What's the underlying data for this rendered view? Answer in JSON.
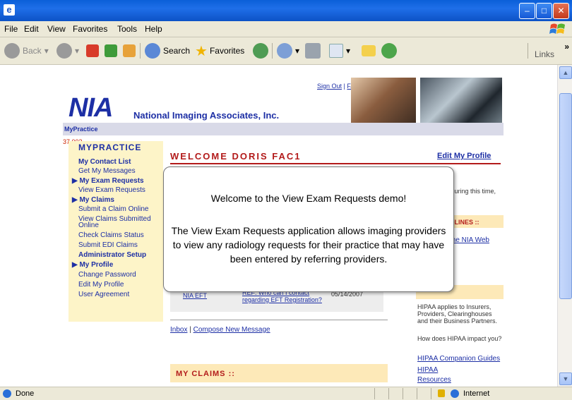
{
  "window": {
    "min": "–",
    "max": "□",
    "close": "✕"
  },
  "menu": [
    "File",
    "Edit",
    "View",
    "Favorites",
    "Tools",
    "Help"
  ],
  "toolbar": {
    "back": "Back",
    "search": "Search",
    "favorites": "Favorites",
    "links": "Links"
  },
  "header": {
    "logo": "NIA",
    "company": "National Imaging Associates, Inc.",
    "sign_out": "Sign Out",
    "faqs": "FAQs",
    "separator": "|",
    "breadcrumb": "MyPractice",
    "version": "37.002"
  },
  "sidebar": {
    "title": "MYPRACTICE",
    "items": [
      {
        "label": "My Contact List",
        "bold": true
      },
      {
        "label": "Get My Messages",
        "bold": false
      },
      {
        "label": "▶ My Exam Requests",
        "bold": true
      },
      {
        "label": "View Exam Requests",
        "bold": false
      },
      {
        "label": "▶ My Claims",
        "bold": true
      },
      {
        "label": "Submit a Claim Online",
        "bold": false
      },
      {
        "label": "View Claims Submitted",
        "bold": false
      },
      {
        "label": "Online",
        "bold": false
      },
      {
        "label": "Check Claims Status",
        "bold": false
      },
      {
        "label": "Submit EDI Claims",
        "bold": false
      },
      {
        "label": "Administrator Setup",
        "bold": true
      },
      {
        "label": "▶ My Profile",
        "bold": true
      },
      {
        "label": "Change Password",
        "bold": false
      },
      {
        "label": "Edit My Profile",
        "bold": false
      },
      {
        "label": "User Agreement",
        "bold": false
      }
    ]
  },
  "main": {
    "welcome": "WELCOME DORIS FAC1",
    "edit_profile": "Edit My Profile",
    "during": "During this time,",
    "headlines": "DLINES ::",
    "nia_web": "the NIA Web",
    "message": {
      "from": "NIA EFT",
      "subject": "REF: Who can I contact regarding EFT Registration?",
      "date": "05/14/2007"
    },
    "inbox": "Inbox",
    "compose": "Compose New Message",
    "my_claims": "MY CLAIMS ::",
    "hipaa_text": "HIPAA applies to Insurers, Providers, Clearinghouses and their Business Partners.",
    "hipaa_question": "How does HIPAA impact you?",
    "hipaa_links": [
      "HIPAA Companion Guides",
      "HIPAA",
      "Resources"
    ]
  },
  "popup": {
    "heading": "Welcome to the View Exam Requests demo!",
    "body": "The View Exam Requests application allows imaging providers to view any radiology requests for their practice that may have been entered by referring providers."
  },
  "status": {
    "left": "Done",
    "zone": "Internet"
  }
}
